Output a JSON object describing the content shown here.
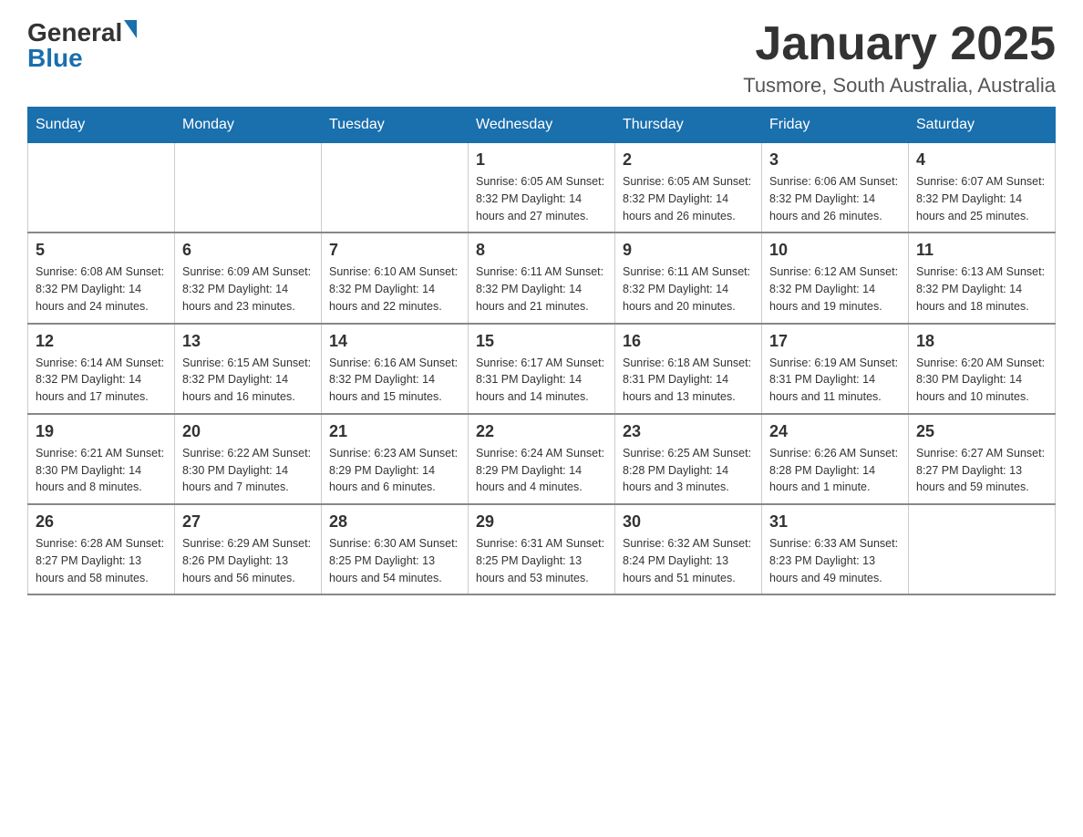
{
  "header": {
    "logo": {
      "general_text": "General",
      "blue_text": "Blue"
    },
    "title": "January 2025",
    "subtitle": "Tusmore, South Australia, Australia"
  },
  "days_of_week": [
    "Sunday",
    "Monday",
    "Tuesday",
    "Wednesday",
    "Thursday",
    "Friday",
    "Saturday"
  ],
  "weeks": [
    {
      "days": [
        {
          "date": "",
          "info": ""
        },
        {
          "date": "",
          "info": ""
        },
        {
          "date": "",
          "info": ""
        },
        {
          "date": "1",
          "info": "Sunrise: 6:05 AM\nSunset: 8:32 PM\nDaylight: 14 hours and 27 minutes."
        },
        {
          "date": "2",
          "info": "Sunrise: 6:05 AM\nSunset: 8:32 PM\nDaylight: 14 hours and 26 minutes."
        },
        {
          "date": "3",
          "info": "Sunrise: 6:06 AM\nSunset: 8:32 PM\nDaylight: 14 hours and 26 minutes."
        },
        {
          "date": "4",
          "info": "Sunrise: 6:07 AM\nSunset: 8:32 PM\nDaylight: 14 hours and 25 minutes."
        }
      ]
    },
    {
      "days": [
        {
          "date": "5",
          "info": "Sunrise: 6:08 AM\nSunset: 8:32 PM\nDaylight: 14 hours and 24 minutes."
        },
        {
          "date": "6",
          "info": "Sunrise: 6:09 AM\nSunset: 8:32 PM\nDaylight: 14 hours and 23 minutes."
        },
        {
          "date": "7",
          "info": "Sunrise: 6:10 AM\nSunset: 8:32 PM\nDaylight: 14 hours and 22 minutes."
        },
        {
          "date": "8",
          "info": "Sunrise: 6:11 AM\nSunset: 8:32 PM\nDaylight: 14 hours and 21 minutes."
        },
        {
          "date": "9",
          "info": "Sunrise: 6:11 AM\nSunset: 8:32 PM\nDaylight: 14 hours and 20 minutes."
        },
        {
          "date": "10",
          "info": "Sunrise: 6:12 AM\nSunset: 8:32 PM\nDaylight: 14 hours and 19 minutes."
        },
        {
          "date": "11",
          "info": "Sunrise: 6:13 AM\nSunset: 8:32 PM\nDaylight: 14 hours and 18 minutes."
        }
      ]
    },
    {
      "days": [
        {
          "date": "12",
          "info": "Sunrise: 6:14 AM\nSunset: 8:32 PM\nDaylight: 14 hours and 17 minutes."
        },
        {
          "date": "13",
          "info": "Sunrise: 6:15 AM\nSunset: 8:32 PM\nDaylight: 14 hours and 16 minutes."
        },
        {
          "date": "14",
          "info": "Sunrise: 6:16 AM\nSunset: 8:32 PM\nDaylight: 14 hours and 15 minutes."
        },
        {
          "date": "15",
          "info": "Sunrise: 6:17 AM\nSunset: 8:31 PM\nDaylight: 14 hours and 14 minutes."
        },
        {
          "date": "16",
          "info": "Sunrise: 6:18 AM\nSunset: 8:31 PM\nDaylight: 14 hours and 13 minutes."
        },
        {
          "date": "17",
          "info": "Sunrise: 6:19 AM\nSunset: 8:31 PM\nDaylight: 14 hours and 11 minutes."
        },
        {
          "date": "18",
          "info": "Sunrise: 6:20 AM\nSunset: 8:30 PM\nDaylight: 14 hours and 10 minutes."
        }
      ]
    },
    {
      "days": [
        {
          "date": "19",
          "info": "Sunrise: 6:21 AM\nSunset: 8:30 PM\nDaylight: 14 hours and 8 minutes."
        },
        {
          "date": "20",
          "info": "Sunrise: 6:22 AM\nSunset: 8:30 PM\nDaylight: 14 hours and 7 minutes."
        },
        {
          "date": "21",
          "info": "Sunrise: 6:23 AM\nSunset: 8:29 PM\nDaylight: 14 hours and 6 minutes."
        },
        {
          "date": "22",
          "info": "Sunrise: 6:24 AM\nSunset: 8:29 PM\nDaylight: 14 hours and 4 minutes."
        },
        {
          "date": "23",
          "info": "Sunrise: 6:25 AM\nSunset: 8:28 PM\nDaylight: 14 hours and 3 minutes."
        },
        {
          "date": "24",
          "info": "Sunrise: 6:26 AM\nSunset: 8:28 PM\nDaylight: 14 hours and 1 minute."
        },
        {
          "date": "25",
          "info": "Sunrise: 6:27 AM\nSunset: 8:27 PM\nDaylight: 13 hours and 59 minutes."
        }
      ]
    },
    {
      "days": [
        {
          "date": "26",
          "info": "Sunrise: 6:28 AM\nSunset: 8:27 PM\nDaylight: 13 hours and 58 minutes."
        },
        {
          "date": "27",
          "info": "Sunrise: 6:29 AM\nSunset: 8:26 PM\nDaylight: 13 hours and 56 minutes."
        },
        {
          "date": "28",
          "info": "Sunrise: 6:30 AM\nSunset: 8:25 PM\nDaylight: 13 hours and 54 minutes."
        },
        {
          "date": "29",
          "info": "Sunrise: 6:31 AM\nSunset: 8:25 PM\nDaylight: 13 hours and 53 minutes."
        },
        {
          "date": "30",
          "info": "Sunrise: 6:32 AM\nSunset: 8:24 PM\nDaylight: 13 hours and 51 minutes."
        },
        {
          "date": "31",
          "info": "Sunrise: 6:33 AM\nSunset: 8:23 PM\nDaylight: 13 hours and 49 minutes."
        },
        {
          "date": "",
          "info": ""
        }
      ]
    }
  ]
}
